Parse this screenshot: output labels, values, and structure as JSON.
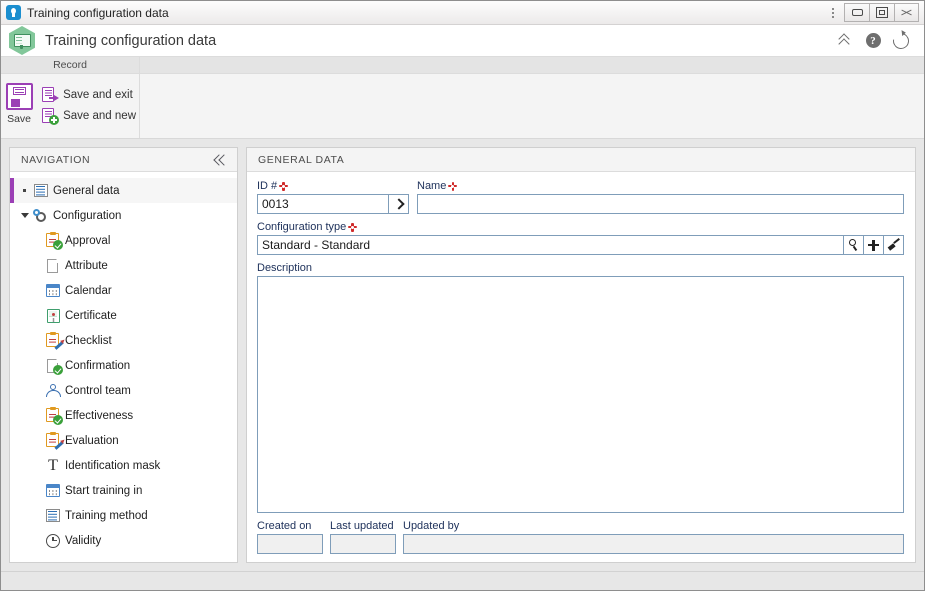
{
  "window": {
    "title": "Training configuration data",
    "icon": "app-logo-icon",
    "menu_icon": "kebab-menu-icon",
    "minimize_label": "minimize-icon",
    "restore_label": "restore-icon",
    "close_label": "close-icon"
  },
  "header": {
    "title": "Training configuration data",
    "icon": "training-hex-icon",
    "actions": [
      {
        "name": "collapse-ribbon-icon",
        "glyph": "chevron-double-up"
      },
      {
        "name": "help-icon",
        "glyph": "question-mark"
      },
      {
        "name": "refresh-icon",
        "glyph": "circular-arrow"
      }
    ]
  },
  "ribbon": {
    "group_caption": "Record",
    "save": {
      "label": "Save",
      "icon": "floppy-disk-icon"
    },
    "save_and_exit": {
      "label": "Save and exit",
      "icon": "save-exit-icon"
    },
    "save_and_new": {
      "label": "Save and new",
      "icon": "save-new-icon"
    }
  },
  "navigation": {
    "title": "NAVIGATION",
    "collapse_icon": "double-chevron-left-icon",
    "items": [
      {
        "label": "General data",
        "icon": "document-lines-icon",
        "level": "root",
        "selected": true,
        "marker": "bullet"
      },
      {
        "label": "Configuration",
        "icon": "gears-icon",
        "level": "group",
        "selected": false,
        "marker": "triangle"
      },
      {
        "label": "Approval",
        "icon": "clipboard-check-icon",
        "level": "child",
        "selected": false,
        "marker": "none"
      },
      {
        "label": "Attribute",
        "icon": "page-icon",
        "level": "child",
        "selected": false,
        "marker": "none"
      },
      {
        "label": "Calendar",
        "icon": "calendar-icon",
        "level": "child",
        "selected": false,
        "marker": "none"
      },
      {
        "label": "Certificate",
        "icon": "certificate-icon",
        "level": "child",
        "selected": false,
        "marker": "none"
      },
      {
        "label": "Checklist",
        "icon": "clipboard-pen-icon",
        "level": "child",
        "selected": false,
        "marker": "none"
      },
      {
        "label": "Confirmation",
        "icon": "page-check-icon",
        "level": "child",
        "selected": false,
        "marker": "none"
      },
      {
        "label": "Control team",
        "icon": "people-icon",
        "level": "child",
        "selected": false,
        "marker": "none"
      },
      {
        "label": "Effectiveness",
        "icon": "clipboard-check-icon",
        "level": "child",
        "selected": false,
        "marker": "none"
      },
      {
        "label": "Evaluation",
        "icon": "clipboard-pen-icon",
        "level": "child",
        "selected": false,
        "marker": "none"
      },
      {
        "label": "Identification mask",
        "icon": "text-T-icon",
        "level": "child",
        "selected": false,
        "marker": "none"
      },
      {
        "label": "Start training in",
        "icon": "calendar-icon",
        "level": "child",
        "selected": false,
        "marker": "none"
      },
      {
        "label": "Training method",
        "icon": "document-lines-icon",
        "level": "child",
        "selected": false,
        "marker": "none"
      },
      {
        "label": "Validity",
        "icon": "clock-icon",
        "level": "child",
        "selected": false,
        "marker": "none"
      }
    ]
  },
  "content": {
    "section_title": "GENERAL DATA",
    "fields": {
      "id": {
        "label": "ID #",
        "required": true,
        "value": "0013",
        "placeholder": "",
        "button_icon": "chevron-right-icon"
      },
      "name": {
        "label": "Name",
        "required": true,
        "value": "",
        "placeholder": ""
      },
      "configuration_type": {
        "label": "Configuration type",
        "required": true,
        "value": "Standard - Standard",
        "placeholder": "",
        "buttons": [
          {
            "name": "lookup-search-icon",
            "glyph": "magnifier"
          },
          {
            "name": "add-new-icon",
            "glyph": "plus"
          },
          {
            "name": "clear-field-icon",
            "glyph": "brush"
          }
        ]
      },
      "description": {
        "label": "Description",
        "required": false,
        "value": "",
        "placeholder": ""
      },
      "created_on": {
        "label": "Created on",
        "required": false,
        "value": "",
        "readonly": true
      },
      "last_updated": {
        "label": "Last updated",
        "required": false,
        "value": "",
        "readonly": true
      },
      "updated_by": {
        "label": "Updated by",
        "required": false,
        "value": "",
        "readonly": true
      }
    }
  },
  "colors": {
    "accent_purple": "#9b3fb5",
    "required_red": "#d02b2b",
    "label_blue": "#20335c",
    "field_border": "#7f9db9",
    "hex_green": "#82c79a",
    "title_icon_blue": "#1b8ecf"
  }
}
